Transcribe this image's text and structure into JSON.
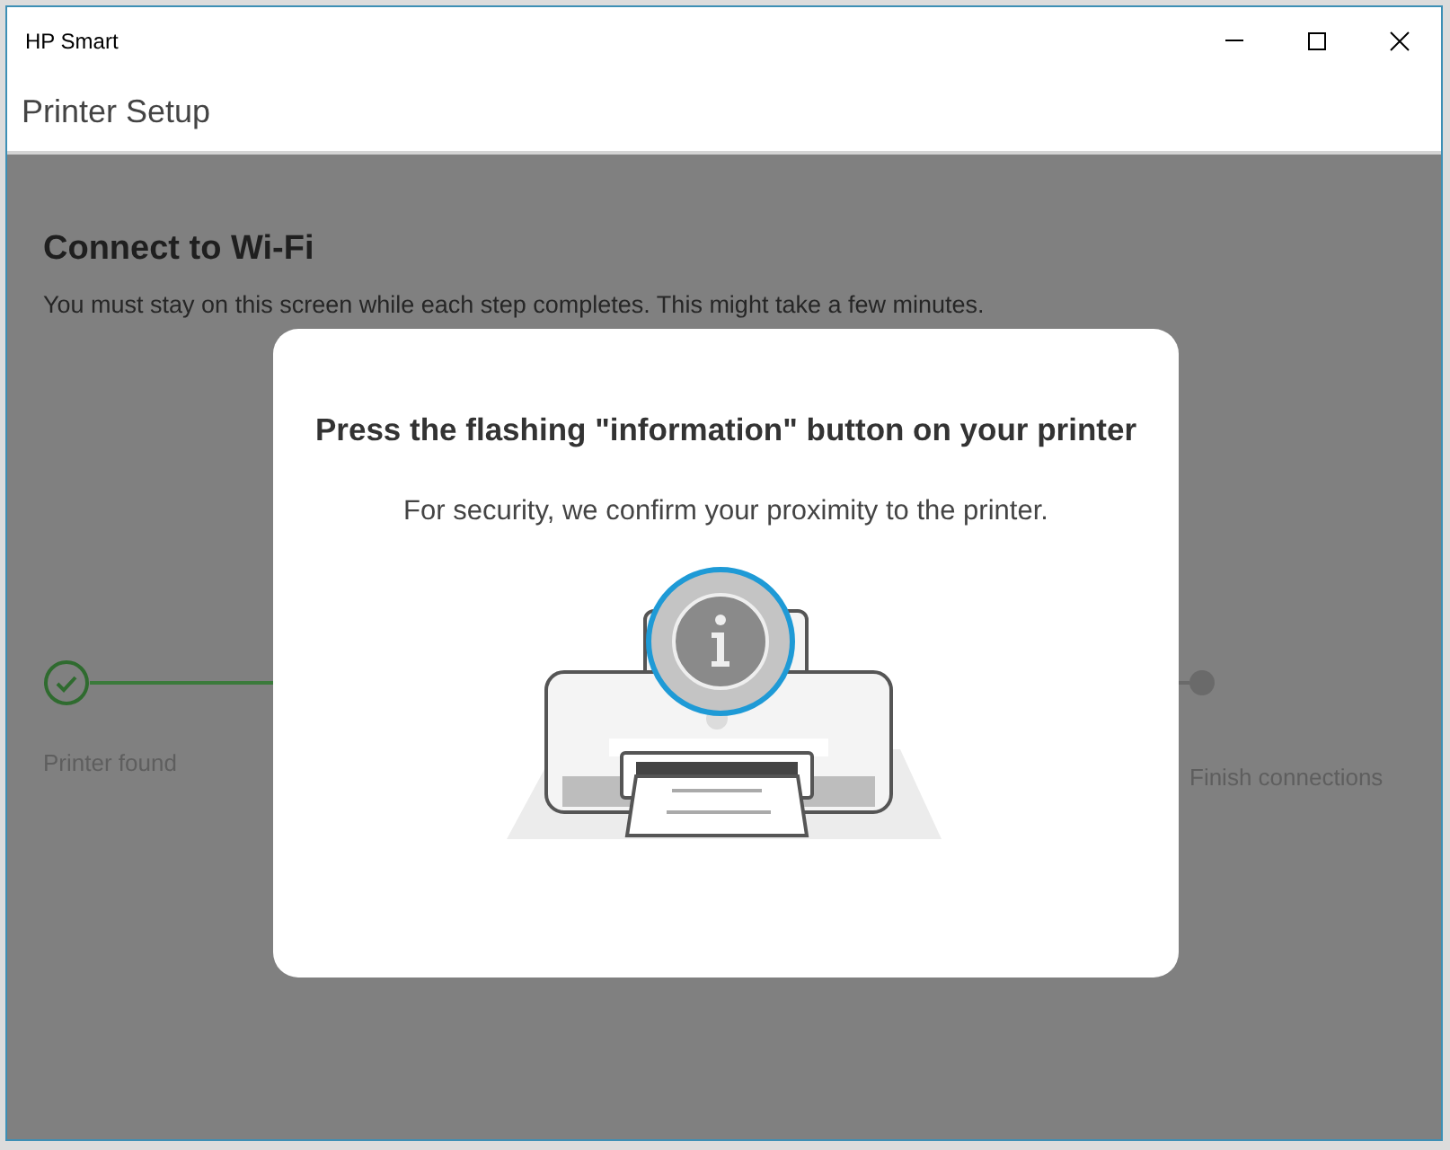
{
  "window": {
    "title": "HP Smart"
  },
  "header": {
    "title": "Printer Setup"
  },
  "page": {
    "title": "Connect to Wi-Fi",
    "subtitle": "You must stay on this screen while each step completes. This might take a few minutes."
  },
  "steps": [
    {
      "label": "Printer found",
      "completed": true
    },
    {
      "label": "Finish connections",
      "completed": false
    }
  ],
  "dialog": {
    "title": "Press the flashing \"information\" button on your printer",
    "message": "For security, we confirm your proximity to the printer."
  }
}
